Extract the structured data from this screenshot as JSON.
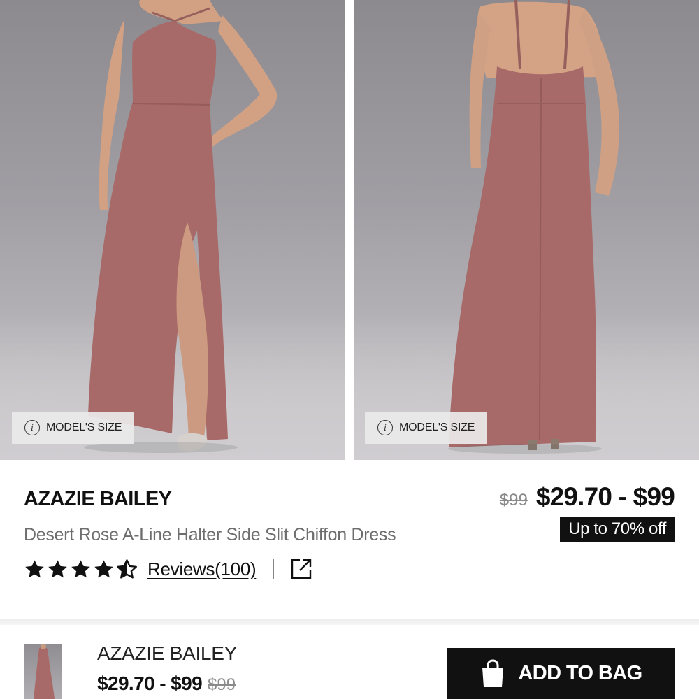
{
  "gallery": {
    "images": [
      {
        "view": "front",
        "model_size_label": "MODEL'S SIZE",
        "info_icon": "info-icon"
      },
      {
        "view": "back",
        "model_size_label": "MODEL'S SIZE",
        "info_icon": "info-icon"
      }
    ]
  },
  "product": {
    "brand": "AZAZIE BAILEY",
    "subtitle": "Desert Rose A-Line Halter Side Slit Chiffon Dress",
    "original_price": "$99",
    "price_range": "$29.70 - $99",
    "discount_badge": "Up to 70% off",
    "rating": {
      "stars": 4.5,
      "max": 5,
      "reviews_label": "Reviews(100)"
    },
    "share_icon": "share-external-icon"
  },
  "sticky_bar": {
    "brand": "AZAZIE BAILEY",
    "price_range": "$29.70 - $99",
    "original_price": "$99",
    "add_to_bag_label": "ADD TO BAG",
    "bag_icon": "shopping-bag-icon"
  },
  "colors": {
    "dress": "#a86a68",
    "background": "#a19fa4",
    "text_primary": "#111111",
    "text_secondary": "#6d6d6d",
    "badge_bg": "#111111"
  }
}
